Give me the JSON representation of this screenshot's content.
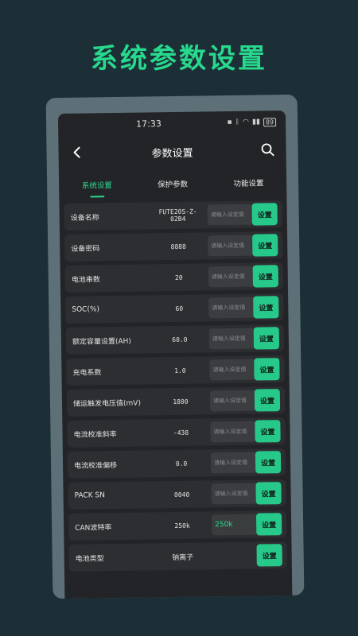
{
  "hero_title": "系统参数设置",
  "status_bar": {
    "time": "17:33",
    "battery": "89"
  },
  "nav": {
    "title": "参数设置"
  },
  "tabs": [
    {
      "label": "系统设置",
      "active": true
    },
    {
      "label": "保护参数",
      "active": false
    },
    {
      "label": "功能设置",
      "active": false
    }
  ],
  "input_placeholder": "请输入设定值",
  "set_button_label": "设置",
  "rows": [
    {
      "label": "设备名称",
      "value": "FUTE20S-Z-02B4",
      "input": ""
    },
    {
      "label": "设备密码",
      "value": "8888",
      "input": ""
    },
    {
      "label": "电池串数",
      "value": "20",
      "input": ""
    },
    {
      "label": "SOC(%)",
      "value": "60",
      "input": ""
    },
    {
      "label": "额定容量设置(AH)",
      "value": "60.0",
      "input": ""
    },
    {
      "label": "充电系数",
      "value": "1.0",
      "input": ""
    },
    {
      "label": "储运触发电压值(mV)",
      "value": "1800",
      "input": ""
    },
    {
      "label": "电流校准斜率",
      "value": "-438",
      "input": ""
    },
    {
      "label": "电流校准偏移",
      "value": "0.0",
      "input": ""
    },
    {
      "label": "PACK SN",
      "value": "0040",
      "input": ""
    },
    {
      "label": "CAN波特率",
      "value": "250k",
      "input": "250k"
    },
    {
      "label": "电池类型",
      "value": "钠离子",
      "input": null
    }
  ],
  "colors": {
    "accent": "#27d98d",
    "background": "#1c2f36",
    "screen": "#232427",
    "row": "#2d2e31"
  }
}
